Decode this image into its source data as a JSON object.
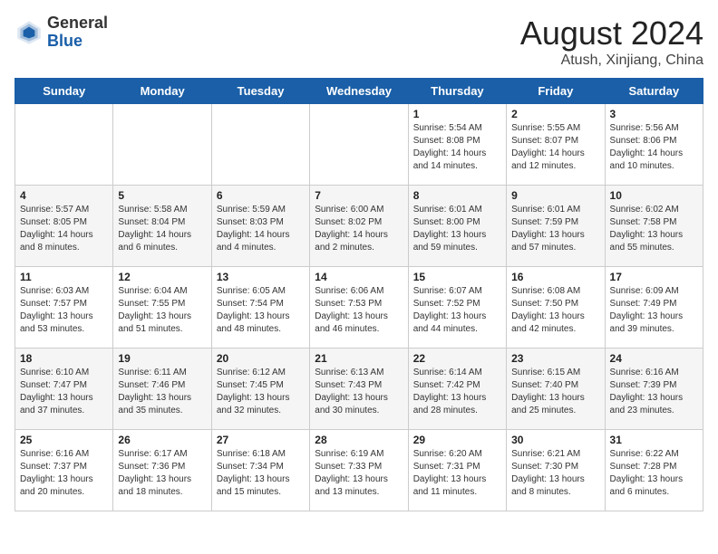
{
  "header": {
    "logo_line1": "General",
    "logo_line2": "Blue",
    "month_title": "August 2024",
    "location": "Atush, Xinjiang, China"
  },
  "weekdays": [
    "Sunday",
    "Monday",
    "Tuesday",
    "Wednesday",
    "Thursday",
    "Friday",
    "Saturday"
  ],
  "weeks": [
    [
      {
        "day": "",
        "info": ""
      },
      {
        "day": "",
        "info": ""
      },
      {
        "day": "",
        "info": ""
      },
      {
        "day": "",
        "info": ""
      },
      {
        "day": "1",
        "info": "Sunrise: 5:54 AM\nSunset: 8:08 PM\nDaylight: 14 hours\nand 14 minutes."
      },
      {
        "day": "2",
        "info": "Sunrise: 5:55 AM\nSunset: 8:07 PM\nDaylight: 14 hours\nand 12 minutes."
      },
      {
        "day": "3",
        "info": "Sunrise: 5:56 AM\nSunset: 8:06 PM\nDaylight: 14 hours\nand 10 minutes."
      }
    ],
    [
      {
        "day": "4",
        "info": "Sunrise: 5:57 AM\nSunset: 8:05 PM\nDaylight: 14 hours\nand 8 minutes."
      },
      {
        "day": "5",
        "info": "Sunrise: 5:58 AM\nSunset: 8:04 PM\nDaylight: 14 hours\nand 6 minutes."
      },
      {
        "day": "6",
        "info": "Sunrise: 5:59 AM\nSunset: 8:03 PM\nDaylight: 14 hours\nand 4 minutes."
      },
      {
        "day": "7",
        "info": "Sunrise: 6:00 AM\nSunset: 8:02 PM\nDaylight: 14 hours\nand 2 minutes."
      },
      {
        "day": "8",
        "info": "Sunrise: 6:01 AM\nSunset: 8:00 PM\nDaylight: 13 hours\nand 59 minutes."
      },
      {
        "day": "9",
        "info": "Sunrise: 6:01 AM\nSunset: 7:59 PM\nDaylight: 13 hours\nand 57 minutes."
      },
      {
        "day": "10",
        "info": "Sunrise: 6:02 AM\nSunset: 7:58 PM\nDaylight: 13 hours\nand 55 minutes."
      }
    ],
    [
      {
        "day": "11",
        "info": "Sunrise: 6:03 AM\nSunset: 7:57 PM\nDaylight: 13 hours\nand 53 minutes."
      },
      {
        "day": "12",
        "info": "Sunrise: 6:04 AM\nSunset: 7:55 PM\nDaylight: 13 hours\nand 51 minutes."
      },
      {
        "day": "13",
        "info": "Sunrise: 6:05 AM\nSunset: 7:54 PM\nDaylight: 13 hours\nand 48 minutes."
      },
      {
        "day": "14",
        "info": "Sunrise: 6:06 AM\nSunset: 7:53 PM\nDaylight: 13 hours\nand 46 minutes."
      },
      {
        "day": "15",
        "info": "Sunrise: 6:07 AM\nSunset: 7:52 PM\nDaylight: 13 hours\nand 44 minutes."
      },
      {
        "day": "16",
        "info": "Sunrise: 6:08 AM\nSunset: 7:50 PM\nDaylight: 13 hours\nand 42 minutes."
      },
      {
        "day": "17",
        "info": "Sunrise: 6:09 AM\nSunset: 7:49 PM\nDaylight: 13 hours\nand 39 minutes."
      }
    ],
    [
      {
        "day": "18",
        "info": "Sunrise: 6:10 AM\nSunset: 7:47 PM\nDaylight: 13 hours\nand 37 minutes."
      },
      {
        "day": "19",
        "info": "Sunrise: 6:11 AM\nSunset: 7:46 PM\nDaylight: 13 hours\nand 35 minutes."
      },
      {
        "day": "20",
        "info": "Sunrise: 6:12 AM\nSunset: 7:45 PM\nDaylight: 13 hours\nand 32 minutes."
      },
      {
        "day": "21",
        "info": "Sunrise: 6:13 AM\nSunset: 7:43 PM\nDaylight: 13 hours\nand 30 minutes."
      },
      {
        "day": "22",
        "info": "Sunrise: 6:14 AM\nSunset: 7:42 PM\nDaylight: 13 hours\nand 28 minutes."
      },
      {
        "day": "23",
        "info": "Sunrise: 6:15 AM\nSunset: 7:40 PM\nDaylight: 13 hours\nand 25 minutes."
      },
      {
        "day": "24",
        "info": "Sunrise: 6:16 AM\nSunset: 7:39 PM\nDaylight: 13 hours\nand 23 minutes."
      }
    ],
    [
      {
        "day": "25",
        "info": "Sunrise: 6:16 AM\nSunset: 7:37 PM\nDaylight: 13 hours\nand 20 minutes."
      },
      {
        "day": "26",
        "info": "Sunrise: 6:17 AM\nSunset: 7:36 PM\nDaylight: 13 hours\nand 18 minutes."
      },
      {
        "day": "27",
        "info": "Sunrise: 6:18 AM\nSunset: 7:34 PM\nDaylight: 13 hours\nand 15 minutes."
      },
      {
        "day": "28",
        "info": "Sunrise: 6:19 AM\nSunset: 7:33 PM\nDaylight: 13 hours\nand 13 minutes."
      },
      {
        "day": "29",
        "info": "Sunrise: 6:20 AM\nSunset: 7:31 PM\nDaylight: 13 hours\nand 11 minutes."
      },
      {
        "day": "30",
        "info": "Sunrise: 6:21 AM\nSunset: 7:30 PM\nDaylight: 13 hours\nand 8 minutes."
      },
      {
        "day": "31",
        "info": "Sunrise: 6:22 AM\nSunset: 7:28 PM\nDaylight: 13 hours\nand 6 minutes."
      }
    ]
  ]
}
